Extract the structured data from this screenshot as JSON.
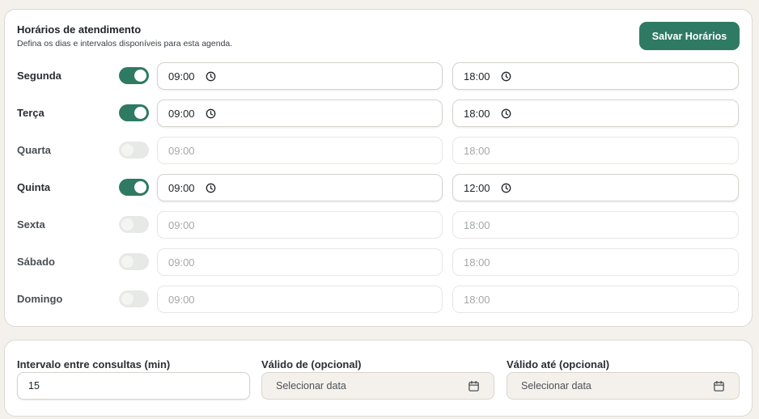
{
  "hours": {
    "title": "Horários de atendimento",
    "subtitle": "Defina os dias e intervalos disponíveis para esta agenda.",
    "save_label": "Salvar Horários",
    "days": [
      {
        "label": "Segunda",
        "enabled": true,
        "start": "09:00",
        "end": "18:00"
      },
      {
        "label": "Terça",
        "enabled": true,
        "start": "09:00",
        "end": "18:00"
      },
      {
        "label": "Quarta",
        "enabled": false,
        "start": "09:00",
        "end": "18:00"
      },
      {
        "label": "Quinta",
        "enabled": true,
        "start": "09:00",
        "end": "12:00"
      },
      {
        "label": "Sexta",
        "enabled": false,
        "start": "09:00",
        "end": "18:00"
      },
      {
        "label": "Sábado",
        "enabled": false,
        "start": "09:00",
        "end": "18:00"
      },
      {
        "label": "Domingo",
        "enabled": false,
        "start": "09:00",
        "end": "18:00"
      }
    ]
  },
  "settings": {
    "interval_label": "Intervalo entre consultas (min)",
    "interval_value": "15",
    "valid_from_label": "Válido de (opcional)",
    "valid_from_placeholder": "Selecionar data",
    "valid_until_label": "Válido até (opcional)",
    "valid_until_placeholder": "Selecionar data"
  },
  "colors": {
    "accent": "#2f7a63",
    "toggle_off": "#e6e9e6",
    "page_background": "#f4f1ec"
  },
  "icons": {
    "time": "clock-icon",
    "date": "calendar-icon"
  }
}
